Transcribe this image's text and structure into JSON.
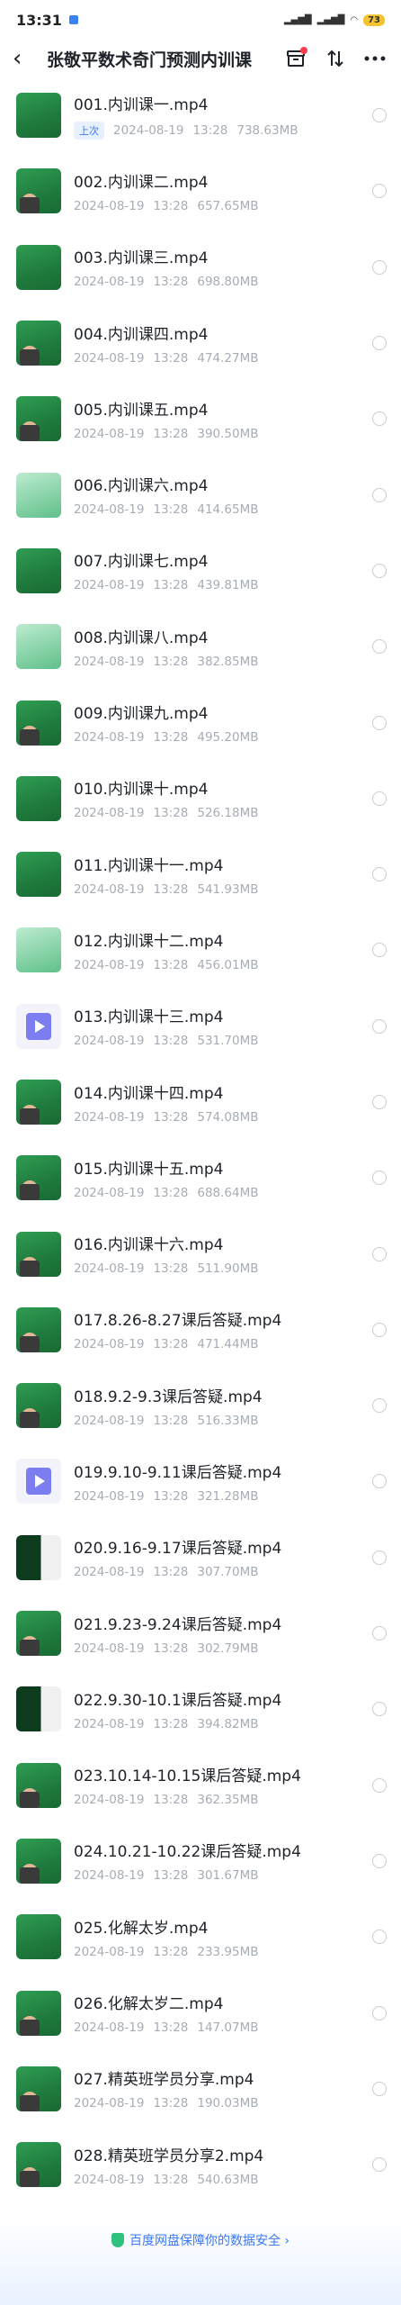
{
  "status": {
    "time": "13:31",
    "battery": "73"
  },
  "header": {
    "title": "张敬平数术奇门预测内训课"
  },
  "items": [
    {
      "name": "001.内训课一.mp4",
      "tag": "上次",
      "date": "2024-08-19",
      "time": "13:28",
      "size": "738.63MB",
      "thumb": "green"
    },
    {
      "name": "002.内训课二.mp4",
      "date": "2024-08-19",
      "time": "13:28",
      "size": "657.65MB",
      "thumb": "person"
    },
    {
      "name": "003.内训课三.mp4",
      "date": "2024-08-19",
      "time": "13:28",
      "size": "698.80MB",
      "thumb": "green"
    },
    {
      "name": "004.内训课四.mp4",
      "date": "2024-08-19",
      "time": "13:28",
      "size": "474.27MB",
      "thumb": "person"
    },
    {
      "name": "005.内训课五.mp4",
      "date": "2024-08-19",
      "time": "13:28",
      "size": "390.50MB",
      "thumb": "person"
    },
    {
      "name": "006.内训课六.mp4",
      "date": "2024-08-19",
      "time": "13:28",
      "size": "414.65MB",
      "thumb": "light"
    },
    {
      "name": "007.内训课七.mp4",
      "date": "2024-08-19",
      "time": "13:28",
      "size": "439.81MB",
      "thumb": "green"
    },
    {
      "name": "008.内训课八.mp4",
      "date": "2024-08-19",
      "time": "13:28",
      "size": "382.85MB",
      "thumb": "light"
    },
    {
      "name": "009.内训课九.mp4",
      "date": "2024-08-19",
      "time": "13:28",
      "size": "495.20MB",
      "thumb": "person"
    },
    {
      "name": "010.内训课十.mp4",
      "date": "2024-08-19",
      "time": "13:28",
      "size": "526.18MB",
      "thumb": "green"
    },
    {
      "name": "011.内训课十一.mp4",
      "date": "2024-08-19",
      "time": "13:28",
      "size": "541.93MB",
      "thumb": "green"
    },
    {
      "name": "012.内训课十二.mp4",
      "date": "2024-08-19",
      "time": "13:28",
      "size": "456.01MB",
      "thumb": "light"
    },
    {
      "name": "013.内训课十三.mp4",
      "date": "2024-08-19",
      "time": "13:28",
      "size": "531.70MB",
      "thumb": "video-icon"
    },
    {
      "name": "014.内训课十四.mp4",
      "date": "2024-08-19",
      "time": "13:28",
      "size": "574.08MB",
      "thumb": "person"
    },
    {
      "name": "015.内训课十五.mp4",
      "date": "2024-08-19",
      "time": "13:28",
      "size": "688.64MB",
      "thumb": "person"
    },
    {
      "name": "016.内训课十六.mp4",
      "date": "2024-08-19",
      "time": "13:28",
      "size": "511.90MB",
      "thumb": "person"
    },
    {
      "name": "017.8.26-8.27课后答疑.mp4",
      "date": "2024-08-19",
      "time": "13:28",
      "size": "471.44MB",
      "thumb": "person"
    },
    {
      "name": "018.9.2-9.3课后答疑.mp4",
      "date": "2024-08-19",
      "time": "13:28",
      "size": "516.33MB",
      "thumb": "person"
    },
    {
      "name": "019.9.10-9.11课后答疑.mp4",
      "date": "2024-08-19",
      "time": "13:28",
      "size": "321.28MB",
      "thumb": "video-icon"
    },
    {
      "name": "020.9.16-9.17课后答疑.mp4",
      "date": "2024-08-19",
      "time": "13:28",
      "size": "307.70MB",
      "thumb": "dark"
    },
    {
      "name": "021.9.23-9.24课后答疑.mp4",
      "date": "2024-08-19",
      "time": "13:28",
      "size": "302.79MB",
      "thumb": "person"
    },
    {
      "name": "022.9.30-10.1课后答疑.mp4",
      "date": "2024-08-19",
      "time": "13:28",
      "size": "394.82MB",
      "thumb": "dark"
    },
    {
      "name": "023.10.14-10.15课后答疑.mp4",
      "date": "2024-08-19",
      "time": "13:28",
      "size": "362.35MB",
      "thumb": "person"
    },
    {
      "name": "024.10.21-10.22课后答疑.mp4",
      "date": "2024-08-19",
      "time": "13:28",
      "size": "301.67MB",
      "thumb": "person"
    },
    {
      "name": "025.化解太岁.mp4",
      "date": "2024-08-19",
      "time": "13:28",
      "size": "233.95MB",
      "thumb": "green"
    },
    {
      "name": "026.化解太岁二.mp4",
      "date": "2024-08-19",
      "time": "13:28",
      "size": "147.07MB",
      "thumb": "person"
    },
    {
      "name": "027.精英班学员分享.mp4",
      "date": "2024-08-19",
      "time": "13:28",
      "size": "190.03MB",
      "thumb": "person"
    },
    {
      "name": "028.精英班学员分享2.mp4",
      "date": "2024-08-19",
      "time": "13:28",
      "size": "540.63MB",
      "thumb": "person"
    }
  ],
  "footer": {
    "text": "百度网盘保障你的数据安全 ›"
  }
}
